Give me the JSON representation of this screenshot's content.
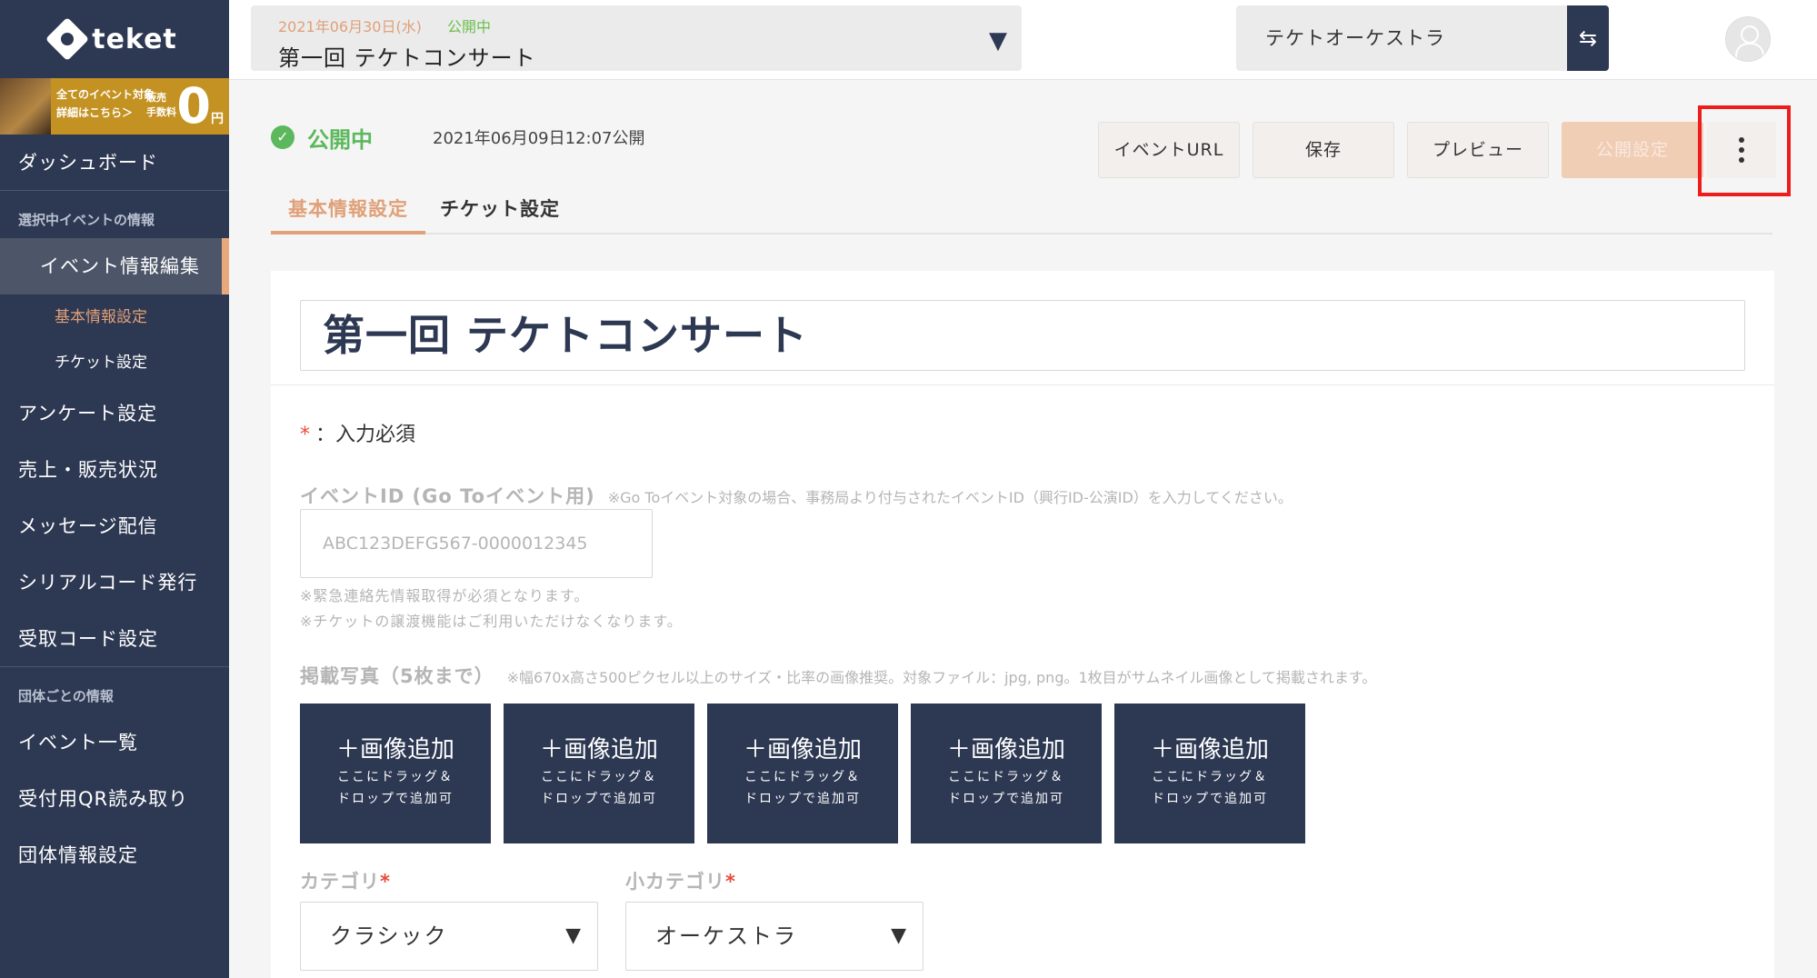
{
  "sidebar": {
    "logo": "teket",
    "banner": {
      "line1": "全てのイベント対象",
      "line2": "詳細はこちら＞",
      "fee_label1": "販売",
      "fee_label2": "手数料",
      "zero": "0",
      "yen": "円"
    },
    "dashboard": "ダッシュボード",
    "section_selected": "選択中イベントの情報",
    "event_edit": "イベント情報編集",
    "sub_basic": "基本情報設定",
    "sub_ticket": "チケット設定",
    "survey": "アンケート設定",
    "sales": "売上・販売状況",
    "message": "メッセージ配信",
    "serial": "シリアルコード発行",
    "receipt": "受取コード設定",
    "section_org": "団体ごとの情報",
    "event_list": "イベント一覧",
    "qr": "受付用QR読み取り",
    "org_settings": "団体情報設定"
  },
  "topbar": {
    "event_date": "2021年06月30日(水)",
    "event_status": "公開中",
    "event_name": "第一回 テケトコンサート",
    "org_name": "テケトオーケストラ"
  },
  "status": {
    "label": "公開中",
    "published_at": "2021年06月09日12:07公開"
  },
  "actions": {
    "event_url": "イベントURL",
    "save": "保存",
    "preview": "プレビュー",
    "publish_settings": "公開設定"
  },
  "tabs": {
    "basic": "基本情報設定",
    "ticket": "チケット設定"
  },
  "form": {
    "title": "第一回 テケトコンサート",
    "required_mark": "*",
    "required_note": "：入力必須",
    "event_id_label": "イベントID (Go Toイベント用)",
    "event_id_hint": "※Go Toイベント対象の場合、事務局より付与されたイベントID（興行ID-公演ID）を入力してください。",
    "event_id_placeholder": "ABC123DEFG567-0000012345",
    "note1": "※緊急連絡先情報取得が必須となります。",
    "note2": "※チケットの譲渡機能はご利用いただけなくなります。",
    "photo_label": "掲載写真（5枚まで）",
    "photo_hint": "※幅670x高さ500ピクセル以上のサイズ・比率の画像推奨。対象ファイル：jpg, png。1枚目がサムネイル画像として掲載されます。",
    "image_tile": {
      "big": "＋画像追加",
      "small1": "ここにドラッグ＆",
      "small2": "ドロップで追加可"
    },
    "category_label": "カテゴリ",
    "category_value": "クラシック",
    "subcategory_label": "小カテゴリ",
    "subcategory_value": "オーケストラ"
  },
  "colors": {
    "sidebar": "#2d3852",
    "accent": "#e0a078",
    "status_green": "#5cb85c",
    "highlight": "#ee1c1c"
  }
}
